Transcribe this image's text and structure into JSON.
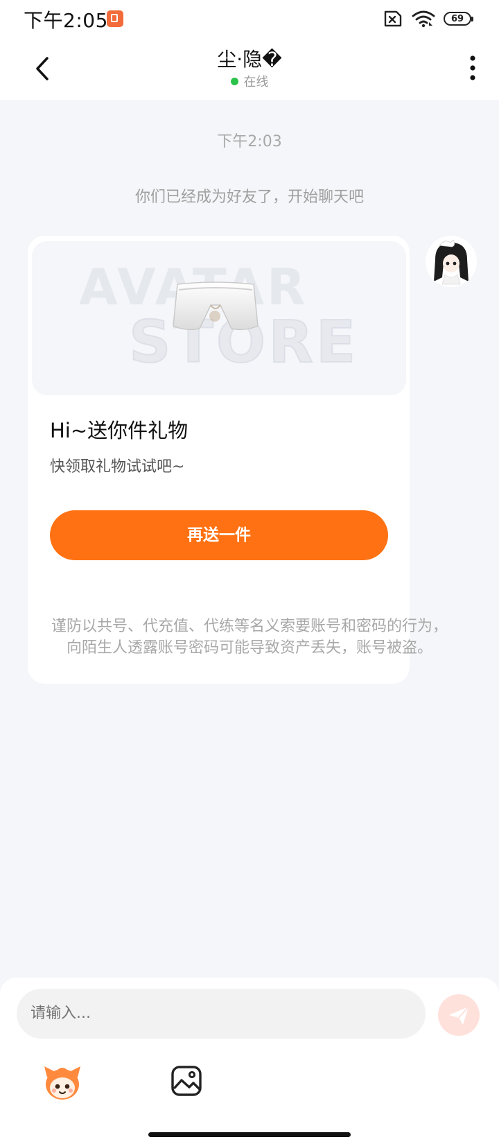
{
  "status_bar": {
    "time": "下午2:05",
    "battery_level": "69"
  },
  "header": {
    "contact_name": "尘·隐�",
    "online_status": "在线"
  },
  "chat": {
    "timestamp": "下午2:03",
    "system_message": "你们已经成为好友了，开始聊天吧",
    "gift_card": {
      "watermark_line1": "AVATAR",
      "watermark_line2": "STORE",
      "title": "Hi~送你件礼物",
      "subtitle": "快领取礼物试试吧~",
      "button_label": "再送一件"
    },
    "warning": "谨防以共号、代充值、代练等名义索要账号和密码的行为，向陌生人透露账号密码可能导致资产丢失，账号被盗。"
  },
  "input_bar": {
    "placeholder": "请输入..."
  },
  "colors": {
    "accent": "#ff7112",
    "online": "#2bc24a",
    "background": "#f4f6f9",
    "send_button": "#ffe1dc"
  },
  "icons": {
    "back": "chevron-left-icon",
    "more": "more-vertical-icon",
    "send": "paper-plane-icon",
    "emoji": "mascot-emoji-icon",
    "image": "image-icon"
  }
}
